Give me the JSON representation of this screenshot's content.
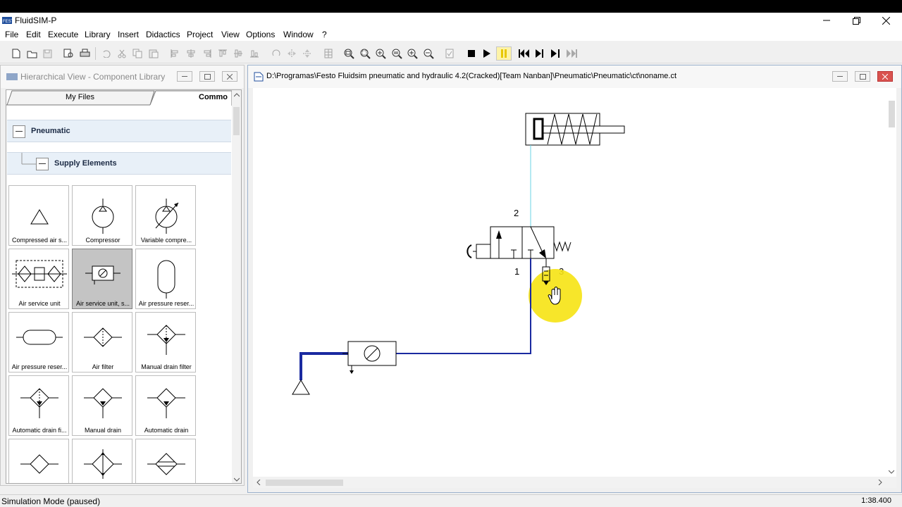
{
  "window": {
    "title": "FluidSIM-P"
  },
  "menu": [
    "File",
    "Edit",
    "Execute",
    "Library",
    "Insert",
    "Didactics",
    "Project",
    "View",
    "Options",
    "Window",
    "?"
  ],
  "library": {
    "title": "Hierarchical View - Component Library",
    "tabs": {
      "my_files": "My Files",
      "common": "Commo"
    },
    "section": "Pneumatic",
    "subsection": "Supply Elements",
    "items": [
      "Compressed air s...",
      "Compressor",
      "Variable compre...",
      "Air service unit",
      "Air service unit, s...",
      "Air pressure reser...",
      "Air pressure reser...",
      "Air filter",
      "Manual drain filter",
      "Automatic drain fi...",
      "Manual drain",
      "Automatic drain",
      "",
      "",
      ""
    ],
    "selected_index": 4
  },
  "document": {
    "title": "D:\\Programas\\Festo Fluidsim pneumatic and hydraulic 4.2(Cracked)[Team Nanban]\\Pneumatic\\Pneumatic\\ct\\noname.ct",
    "port_labels": {
      "p2": "2",
      "p1": "1",
      "p3": "3"
    },
    "colors": {
      "pressurized": "#1a2aa0",
      "vented": "#69d3e6",
      "highlight": "#f6e313"
    }
  },
  "status": {
    "mode": "Simulation Mode (paused)",
    "time": "1:38.400"
  }
}
